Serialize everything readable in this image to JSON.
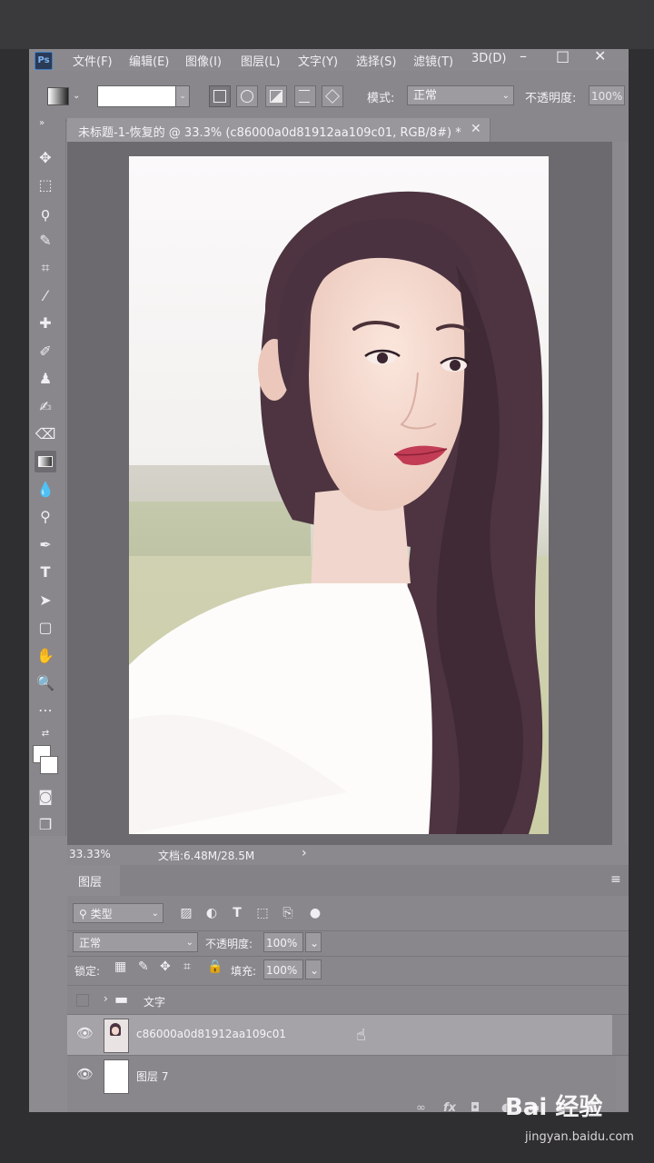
{
  "app": {
    "logo_text": "Ps"
  },
  "menu": [
    "文件(F)",
    "编辑(E)",
    "图像(I)",
    "图层(L)",
    "文字(Y)",
    "选择(S)",
    "滤镜(T)",
    "3D(D)"
  ],
  "window_controls": {
    "minimize": "–",
    "maximize": "□",
    "close": "✕"
  },
  "options_bar": {
    "mode_label": "模式:",
    "mode_value": "正常",
    "opacity_label": "不透明度:",
    "opacity_value": "100%"
  },
  "document_tab": {
    "title": "未标题-1-恢复的 @ 33.3% (c86000a0d81912aa109c01, RGB/8#) *",
    "close": "✕"
  },
  "status_bar": {
    "zoom": "33.33%",
    "doc_info": "文档:6.48M/28.5M",
    "arrow": "›"
  },
  "layers_panel": {
    "tab_label": "图层",
    "filter_kind": "类型",
    "blend_mode": "正常",
    "opacity_label": "不透明度:",
    "opacity_value": "100%",
    "lock_label": "锁定:",
    "fill_label": "填充:",
    "fill_value": "100%",
    "layers": [
      {
        "name": "文字",
        "type": "group",
        "visible": false
      },
      {
        "name": "c86000a0d81912aa109c01",
        "type": "image",
        "visible": true,
        "selected": true
      },
      {
        "name": "图层 7",
        "type": "fill",
        "visible": true
      }
    ]
  },
  "watermark": {
    "logo": "Bai 经验",
    "url": "jingyan.baidu.com"
  },
  "colors": {
    "app_bg": "#8e8b90",
    "canvas_bg": "#6d6a6f",
    "ps_blue": "#3d7fc5"
  }
}
